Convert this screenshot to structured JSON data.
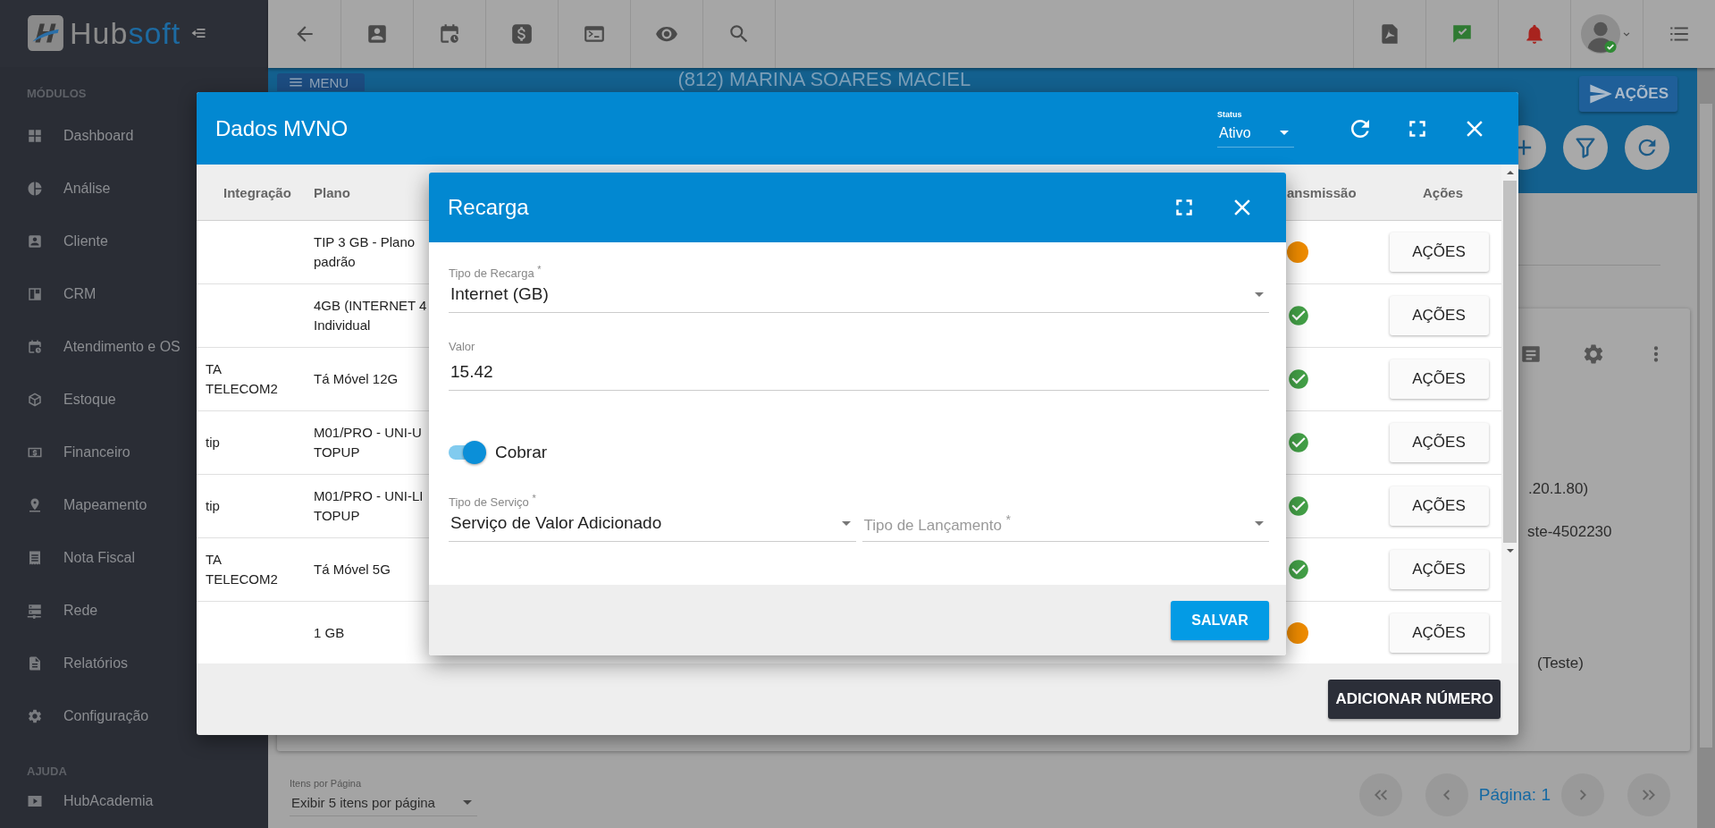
{
  "sidebar": {
    "logo": {
      "part_1": "Hub",
      "part_2": "soft"
    },
    "sections": [
      {
        "title": "MÓDULOS",
        "items": [
          "Dashboard",
          "Análise",
          "Cliente",
          "CRM",
          "Atendimento e OS",
          "Estoque",
          "Financeiro",
          "Mapeamento",
          "Nota Fiscal",
          "Rede",
          "Relatórios",
          "Configuração"
        ]
      },
      {
        "title": "AJUDA",
        "items": [
          "HubAcademia"
        ]
      }
    ]
  },
  "page": {
    "title": "(812) MARINA SOARES MACIEL",
    "menu_button": "MENU",
    "actions_button": "AÇÕES",
    "card_lines": [
      ".20.1.80)",
      "ste-4502230",
      "(Teste)"
    ],
    "page_size": {
      "label": "Itens por Página",
      "value": "Exibir 5 itens por página"
    },
    "pagination": {
      "page": "Página: 1"
    }
  },
  "mvno_dialog": {
    "title": "Dados MVNO",
    "status": {
      "label": "Status",
      "value": "Ativo"
    },
    "columns": [
      "Integração",
      "Plano",
      "ansmissão",
      "Ações"
    ],
    "rows": [
      {
        "plano": "TIP 3 GB - Plano\npadrão",
        "transmitted": false,
        "action": "AÇÕES"
      },
      {
        "plano": "4GB (INTERNET 4\nIndividual",
        "transmitted": true,
        "action": "AÇÕES"
      },
      {
        "integracao": "TA\nTELECOM2",
        "plano": "Tá Móvel 12G",
        "transmitted": true,
        "action": "AÇÕES"
      },
      {
        "integracao": "tip",
        "plano": "M01/PRO - UNI-U\nTOPUP",
        "transmitted": true,
        "action": "AÇÕES"
      },
      {
        "integracao": "tip",
        "plano": "M01/PRO - UNI-LI\nTOPUP",
        "transmitted": true,
        "action": "AÇÕES"
      },
      {
        "integracao": "TA\nTELECOM2",
        "plano": "Tá Móvel 5G",
        "transmitted": true,
        "action": "AÇÕES"
      },
      {
        "plano": "1 GB",
        "transmitted": false,
        "action": "AÇÕES"
      }
    ],
    "add_button": "ADICIONAR NÚMERO"
  },
  "recharge_dialog": {
    "title": "Recarga",
    "rows": [
      [
        {
          "kind": "select",
          "label": "Tipo de Recarga $^{*}$",
          "value": "Internet (GB)"
        }
      ],
      [
        {
          "kind": "text",
          "label": "Valor",
          "value": "15.42"
        }
      ],
      [
        {
          "kind": "toggle",
          "label": "Cobrar",
          "on": true
        }
      ],
      [
        {
          "kind": "select",
          "label": "Tipo de Serviço $^{*}$",
          "value": "Serviço de Valor Adicionado"
        },
        {
          "kind": "select",
          "placeholder": "Tipo de Lançamento $^{*}$"
        }
      ]
    ],
    "save_button": "SALVAR"
  }
}
